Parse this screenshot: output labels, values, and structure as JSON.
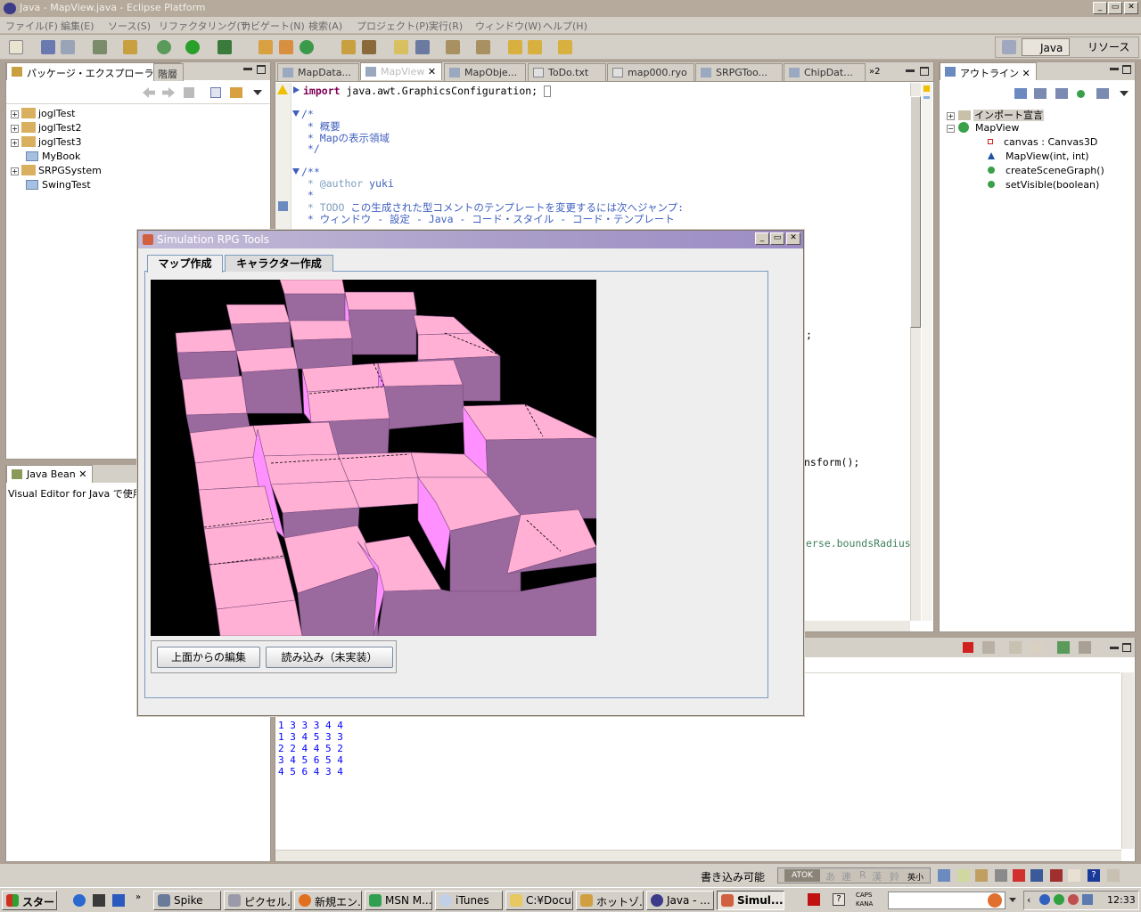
{
  "window": {
    "title": "Java - MapView.java - Eclipse Platform"
  },
  "menu": [
    "ファイル(F)",
    "編集(E)",
    "ソース(S)",
    "リファクタリング(T)",
    "ナビゲート(N)",
    "検索(A)",
    "プロジェクト(P)",
    "実行(R)",
    "ウィンドウ(W)",
    "ヘルプ(H)"
  ],
  "perspectives": {
    "java": "Java",
    "resource": "リソース"
  },
  "left_tabs": {
    "package_explorer": "パッケージ・エクスプローラー",
    "hierarchy": "階層"
  },
  "projects": [
    "joglTest",
    "joglTest2",
    "joglTest3",
    "MyBook",
    "SRPGSystem",
    "SwingTest"
  ],
  "editor_tabs": [
    "MapData...",
    "MapView",
    "MapObje...",
    "ToDo.txt",
    "map000.ryo",
    "SRPGToo...",
    "ChipDat..."
  ],
  "editor_overflow": "»2",
  "code": {
    "l1_kw": "import",
    "l1": " java.awt.GraphicsConfiguration;",
    "c1": "/*",
    "c2": " * 概要",
    "c3": " * Mapの表示領域",
    "c4": " */",
    "d1": "/**",
    "d2_tag": " * @author",
    "d2": " yuki",
    "d3": " *",
    "d4_tag": " * TODO",
    "d4": " この生成された型コメントのテンプレートを変更するには次へジャンプ:",
    "d5": " * ウィンドウ - 設定 - Java - コード・スタイル - コード・テンプレート",
    "frag1": ";",
    "frag2": "nsform();",
    "frag3": "erse.boundsRadius"
  },
  "outline": {
    "tab": "アウトライン",
    "imports": "インポート宣言",
    "class": "MapView",
    "members": [
      "canvas : Canvas3D",
      "MapView(int, int)",
      "createSceneGraph()",
      "setVisible(boolean)"
    ]
  },
  "javabean": {
    "tab": "Java Bean",
    "text": "Visual Editor for Java で使用"
  },
  "console": {
    "rows": [
      "1 3 3 3 4 4",
      "1 3 4 5 3 3",
      "2 2 4 4 5 2",
      "3 4 5 6 5 4",
      "4 5 6 4 3 4"
    ]
  },
  "status": {
    "writable": "書き込み可能",
    "atok": "ATOK",
    "ime": [
      "あ",
      "連",
      "R",
      "漢",
      "鈴",
      "英小"
    ],
    "caps": "CAPS",
    "kana": "KANA"
  },
  "srpg": {
    "title": "Simulation RPG Tools",
    "tabs": [
      "マップ作成",
      "キャラクター作成"
    ],
    "buttons": {
      "edit_top": "上面からの編集",
      "load": "読み込み（未実装）"
    }
  },
  "taskbar": {
    "start": "スタート",
    "items": [
      "Spike",
      "ピクセル...",
      "新規エン...",
      "MSN M...",
      "iTunes",
      "C:¥Docu...",
      "ホットゾ...",
      "Java - ...",
      "Simul..."
    ],
    "clock": "12:33"
  },
  "colors": {
    "top": "#ffb0d4",
    "side_light": "#ff90ff",
    "side_dark": "#9a6a9e",
    "bg3d": "#000000"
  }
}
